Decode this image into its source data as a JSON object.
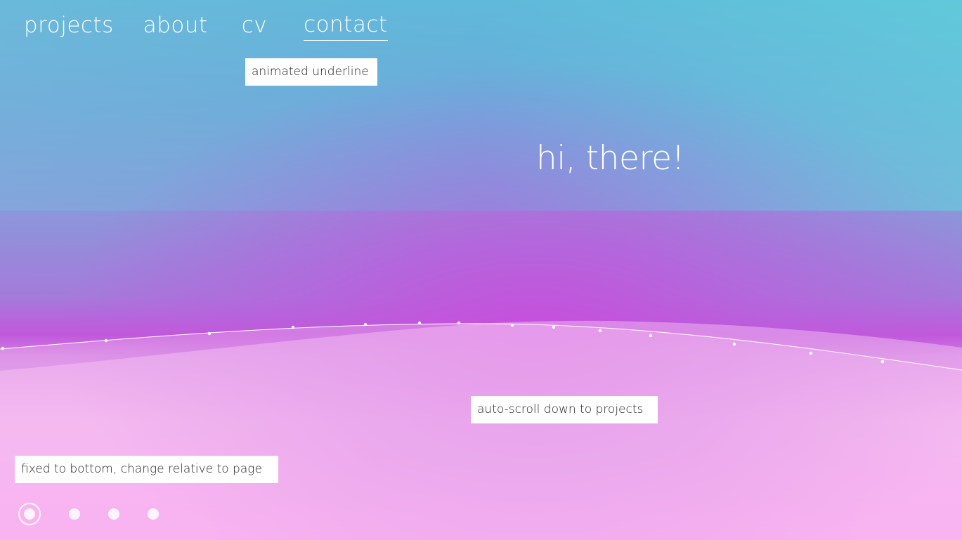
{
  "nav": {
    "items": [
      {
        "label": "projects"
      },
      {
        "label": "about"
      },
      {
        "label": "cv"
      },
      {
        "label": "contact"
      }
    ]
  },
  "hero": {
    "greeting": "hi, there!"
  },
  "annotations": {
    "animated_underline": "animated underline",
    "auto_scroll": "auto-scroll down to projects",
    "fixed_bottom": "fixed to bottom, change relative to page"
  },
  "page_indicator": {
    "count": 4,
    "active_index": 0
  },
  "colors": {
    "sky_top": "#62b7d8",
    "magenta_mid": "#c158dc",
    "pink_bottom": "#fb94ee",
    "text": "#ffffff"
  }
}
